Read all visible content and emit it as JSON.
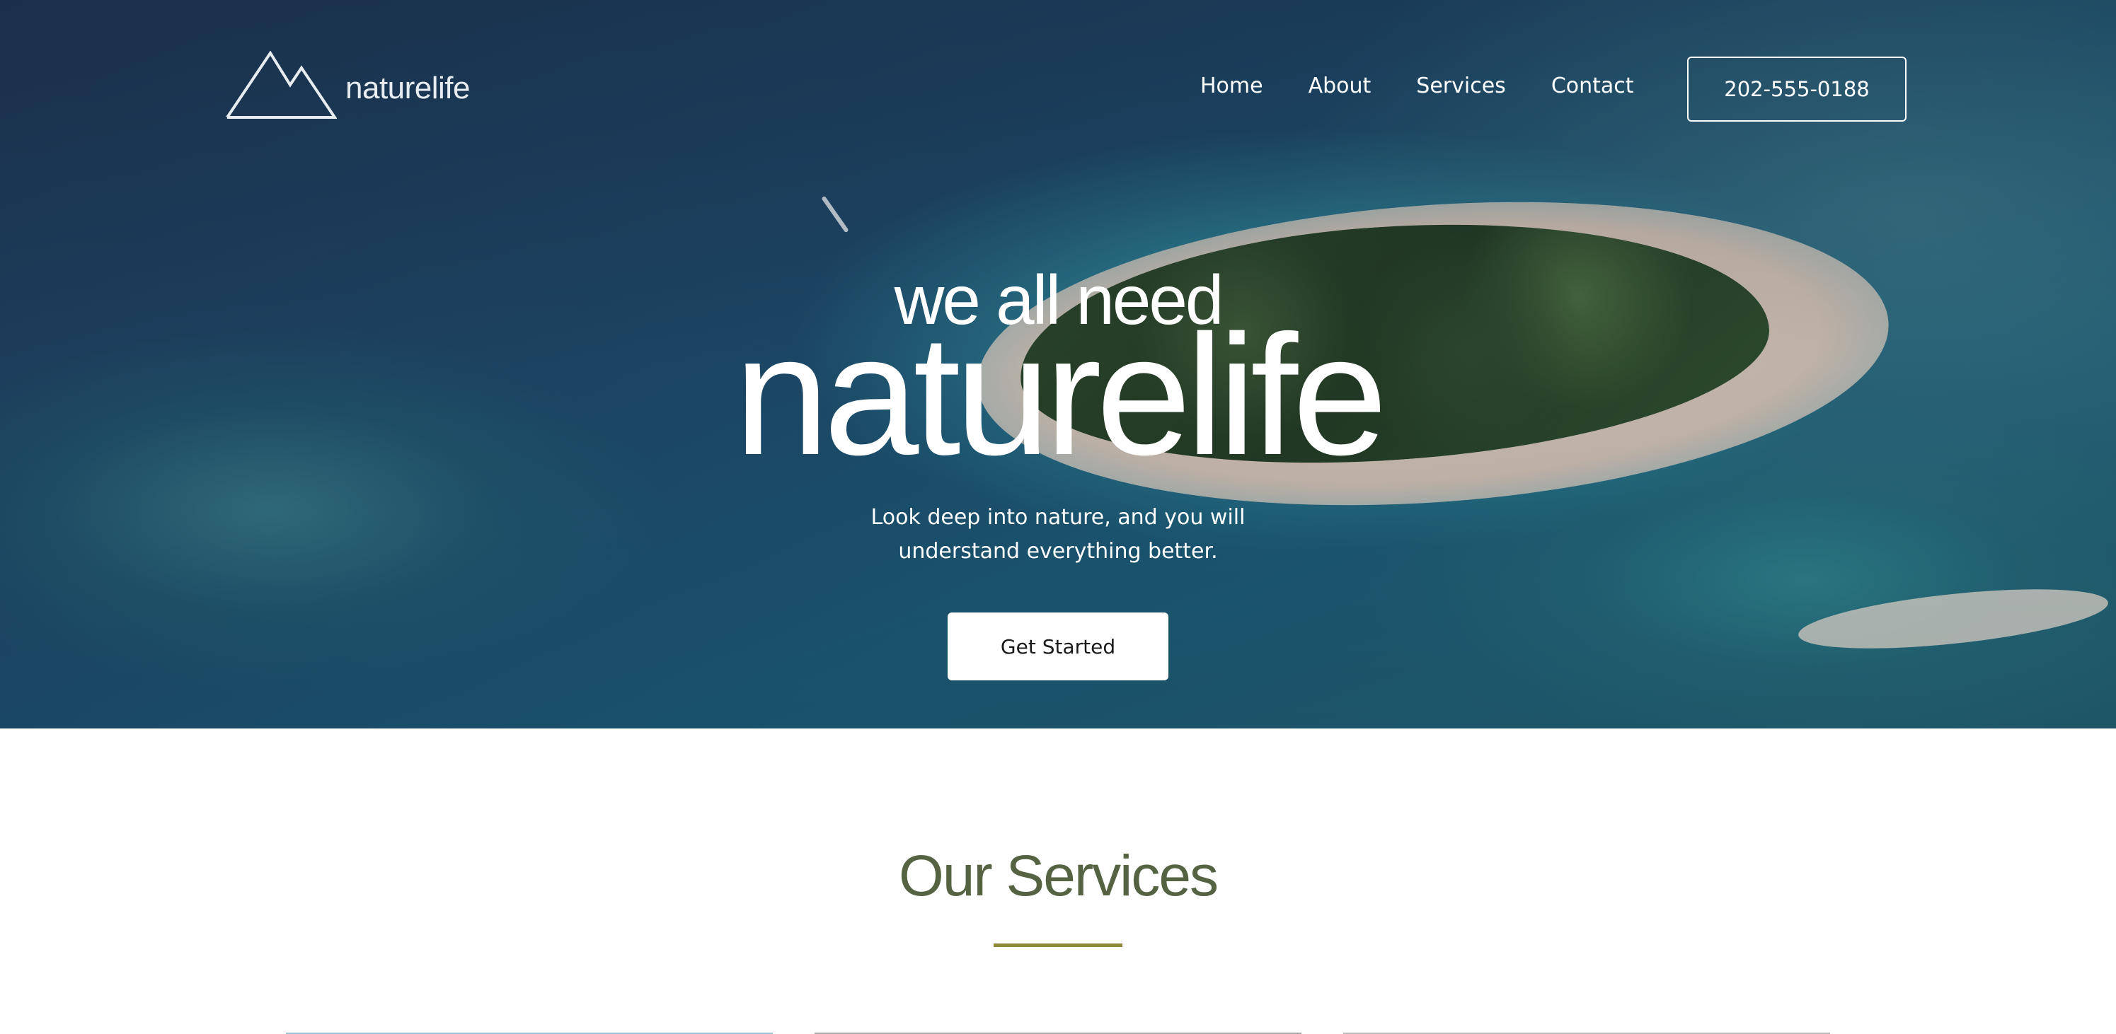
{
  "brand": {
    "name": "naturelife",
    "logo_icon": "mountain-icon"
  },
  "nav": {
    "links": [
      "Home",
      "About",
      "Services",
      "Contact"
    ],
    "phone": "202-555-0188"
  },
  "hero": {
    "tagline": "we all need",
    "headline": "naturelife",
    "subtitle_line1": "Look deep into nature, and you will",
    "subtitle_line2": "understand everything better.",
    "cta_label": "Get Started"
  },
  "services": {
    "title": "Our Services",
    "accent_color": "#8f8a3a",
    "title_color": "#556342"
  }
}
